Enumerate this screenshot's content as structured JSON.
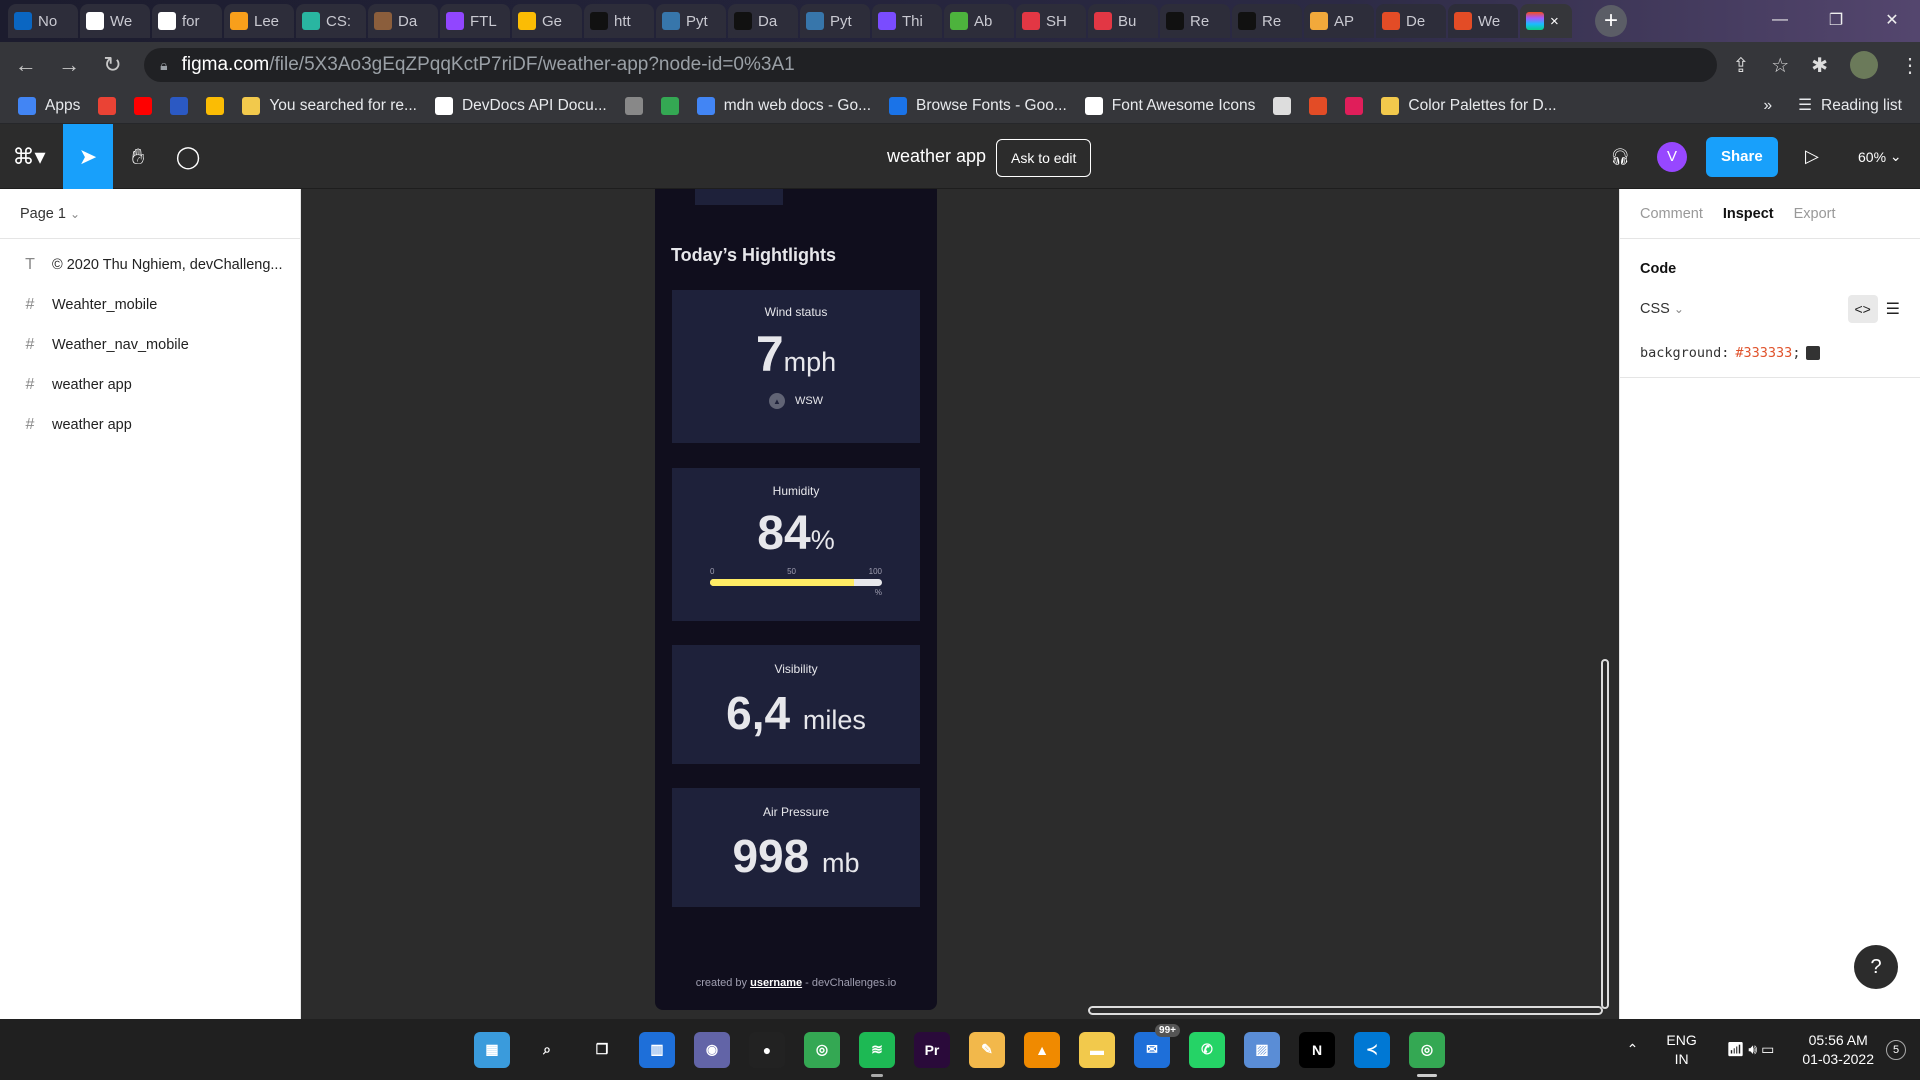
{
  "browser": {
    "tabs": [
      {
        "label": "No",
        "icon": "linkedin-icon",
        "color": "#0a66c2"
      },
      {
        "label": "We",
        "icon": "github-icon",
        "color": "#ffffff"
      },
      {
        "label": "for",
        "icon": "github-icon",
        "color": "#ffffff"
      },
      {
        "label": "Lee",
        "icon": "leetcode-icon",
        "color": "#f89f1b"
      },
      {
        "label": "CS:",
        "icon": "csx-icon",
        "color": "#29b6a1"
      },
      {
        "label": "Da",
        "icon": "cc-icon",
        "color": "#8b5e3c"
      },
      {
        "label": "FTL",
        "icon": "twitch-icon",
        "color": "#9146ff"
      },
      {
        "label": "Ge",
        "icon": "keep-icon",
        "color": "#fbbc04"
      },
      {
        "label": "htt",
        "icon": "lambda-icon",
        "color": "#111111"
      },
      {
        "label": "Pyt",
        "icon": "python-icon",
        "color": "#3776ab"
      },
      {
        "label": "Da",
        "icon": "hn-icon",
        "color": "#111111"
      },
      {
        "label": "Pyt",
        "icon": "python-icon",
        "color": "#3776ab"
      },
      {
        "label": "Thi",
        "icon": "u-icon",
        "color": "#7a4cff"
      },
      {
        "label": "Ab",
        "icon": "mongo-icon",
        "color": "#4db33d"
      },
      {
        "label": "SH",
        "icon": "m-icon",
        "color": "#e23744"
      },
      {
        "label": "Bu",
        "icon": "m-icon",
        "color": "#e23744"
      },
      {
        "label": "Re",
        "icon": "box-icon",
        "color": "#111111"
      },
      {
        "label": "Re",
        "icon": "box-icon",
        "color": "#111111"
      },
      {
        "label": "AP",
        "icon": "cloud-icon",
        "color": "#f2a93b"
      },
      {
        "label": "De",
        "icon": "devchallenges-icon",
        "color": "#e34c26"
      },
      {
        "label": "We",
        "icon": "code-icon",
        "color": "#e34c26"
      }
    ],
    "active_tab_icon": "figma-icon",
    "active_tab_close": "×",
    "new_tab": "+",
    "url_host": "figma.com",
    "url_path": "/file/5X3Ao3gEqZPqqKctP7riDF/weather-app?node-id=0%3A1",
    "bookmarks": [
      {
        "label": "Apps",
        "icon": "apps-grid-icon",
        "color": "#4285f4"
      },
      {
        "label": "",
        "icon": "gmail-icon",
        "color": "#ea4335"
      },
      {
        "label": "",
        "icon": "youtube-icon",
        "color": "#ff0000"
      },
      {
        "label": "",
        "icon": "dh-icon",
        "color": "#2b59c3"
      },
      {
        "label": "",
        "icon": "keep-icon",
        "color": "#fbbc04"
      },
      {
        "label": "You searched for re...",
        "icon": "sun-icon",
        "color": "#f2c94c"
      },
      {
        "label": "DevDocs API Docu...",
        "icon": "devdocs-icon",
        "color": "#ffffff"
      },
      {
        "label": "",
        "icon": "gauge-icon",
        "color": "#888888"
      },
      {
        "label": "",
        "icon": "image-icon",
        "color": "#34a853"
      },
      {
        "label": "mdn web docs - Go...",
        "icon": "google-icon",
        "color": "#4285f4"
      },
      {
        "label": "Browse Fonts - Goo...",
        "icon": "fonts-icon",
        "color": "#1a73e8"
      },
      {
        "label": "Font Awesome Icons",
        "icon": "flag-icon",
        "color": "#ffffff"
      },
      {
        "label": "",
        "icon": "page-icon",
        "color": "#dddddd"
      },
      {
        "label": "",
        "icon": "code-icon",
        "color": "#e34c26"
      },
      {
        "label": "",
        "icon": "slack-icon",
        "color": "#e01e5a"
      },
      {
        "label": "Color Palettes for D...",
        "icon": "palette-icon",
        "color": "#f2c94c"
      }
    ],
    "more": "»",
    "reading_list": "Reading list"
  },
  "figma": {
    "doc_title": "weather app",
    "ask_to_edit": "Ask to edit",
    "avatar_initial": "V",
    "share": "Share",
    "zoom": "60%",
    "page_selector": "Page 1",
    "layers": [
      {
        "type_icon": "T",
        "name": "© 2020 Thu Nghiem, devChalleng..."
      },
      {
        "type_icon": "#",
        "name": "Weahter_mobile"
      },
      {
        "type_icon": "#",
        "name": "Weather_nav_mobile"
      },
      {
        "type_icon": "#",
        "name": "weather app"
      },
      {
        "type_icon": "#",
        "name": "weather app"
      }
    ],
    "inspect": {
      "tabs": [
        "Comment",
        "Inspect",
        "Export"
      ],
      "active_tab": "Inspect",
      "section": "Code",
      "language": "CSS",
      "code_prop": "background:",
      "code_value": "#333333",
      "code_end": ";",
      "swatch_color": "#333333"
    },
    "help": "?"
  },
  "design": {
    "highlights_title": "Today’s Hightlights",
    "wind": {
      "label": "Wind status",
      "value": "7",
      "unit": "mph",
      "direction": "WSW"
    },
    "humidity": {
      "label": "Humidity",
      "value": "84",
      "unit": "%",
      "scale": [
        "0",
        "50",
        "100"
      ],
      "scale_unit": "%",
      "fill_percent": 84
    },
    "visibility": {
      "label": "Visibility",
      "value": "6,4",
      "unit": "miles"
    },
    "pressure": {
      "label": "Air Pressure",
      "value": "998",
      "unit": "mb"
    },
    "footer_prefix": "created by",
    "footer_user": "username",
    "footer_suffix": "- devChallenges.io"
  },
  "taskbar": {
    "apps": [
      {
        "name": "windows-start-icon",
        "color": "#3a9bdc",
        "glyph": "▦"
      },
      {
        "name": "search-icon",
        "color": "transparent",
        "glyph": "⌕"
      },
      {
        "name": "task-view-icon",
        "color": "transparent",
        "glyph": "❐"
      },
      {
        "name": "widgets-icon",
        "color": "#1e6fd9",
        "glyph": "▥"
      },
      {
        "name": "teams-chat-icon",
        "color": "#6264a7",
        "glyph": "◉"
      },
      {
        "name": "record-icon",
        "color": "#222222",
        "glyph": "●"
      },
      {
        "name": "chrome-icon",
        "color": "#34a853",
        "glyph": "◎"
      },
      {
        "name": "spotify-icon",
        "color": "#1db954",
        "glyph": "≋"
      },
      {
        "name": "premiere-icon",
        "color": "#2a0a3a",
        "glyph": "Pr"
      },
      {
        "name": "paint-icon",
        "color": "#f2b84b",
        "glyph": "✎"
      },
      {
        "name": "vlc-icon",
        "color": "#f08a00",
        "glyph": "▲"
      },
      {
        "name": "file-explorer-icon",
        "color": "#f2c94c",
        "glyph": "▬"
      },
      {
        "name": "mail-icon",
        "color": "#1e6fd9",
        "glyph": "✉"
      },
      {
        "name": "whatsapp-icon",
        "color": "#25d366",
        "glyph": "✆"
      },
      {
        "name": "photos-icon",
        "color": "#5a8dd6",
        "glyph": "▨"
      },
      {
        "name": "netflix-icon",
        "color": "#000000",
        "glyph": "N"
      },
      {
        "name": "vscode-icon",
        "color": "#0078d4",
        "glyph": "≺"
      },
      {
        "name": "chrome-icon",
        "color": "#34a853",
        "glyph": "◎"
      }
    ],
    "mail_badge": "99+",
    "lang_top": "ENG",
    "lang_bottom": "IN",
    "time": "05:56 AM",
    "date": "01-03-2022",
    "notifications": "5"
  }
}
